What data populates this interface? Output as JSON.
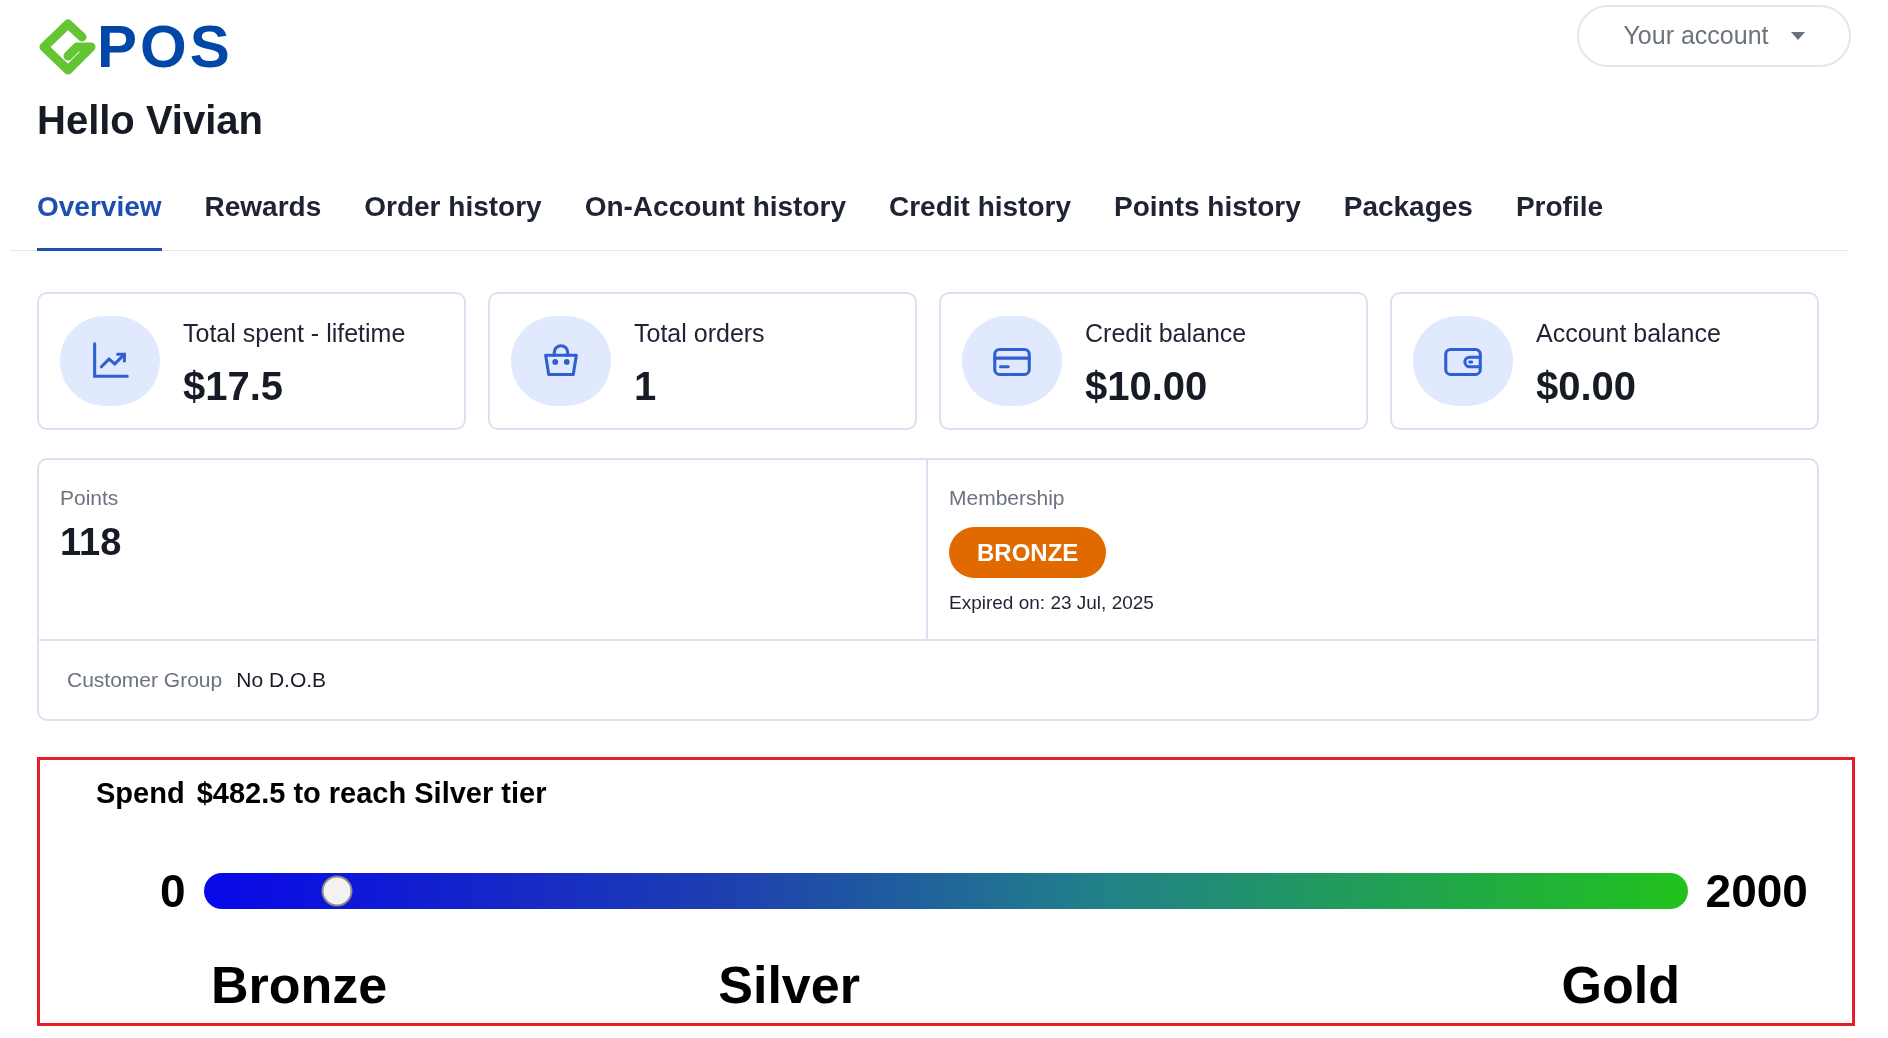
{
  "header": {
    "logo": {
      "text": "POS"
    },
    "greeting": "Hello Vivian",
    "account_button": {
      "label": "Your account"
    }
  },
  "tabs": [
    {
      "label": "Overview",
      "selected": true
    },
    {
      "label": "Rewards",
      "selected": false
    },
    {
      "label": "Order history",
      "selected": false
    },
    {
      "label": "On-Account history",
      "selected": false
    },
    {
      "label": "Credit history",
      "selected": false
    },
    {
      "label": "Points history",
      "selected": false
    },
    {
      "label": "Packages",
      "selected": false
    },
    {
      "label": "Profile",
      "selected": false
    }
  ],
  "stats": [
    {
      "label": "Total spent - lifetime",
      "value": "$17.5"
    },
    {
      "label": "Total orders",
      "value": "1"
    },
    {
      "label": "Credit balance",
      "value": "$10.00"
    },
    {
      "label": "Account balance",
      "value": "$0.00"
    }
  ],
  "points": {
    "label": "Points",
    "value": "118"
  },
  "membership": {
    "label": "Membership",
    "tier": "BRONZE",
    "expiry": "Expired on: 23 Jul, 2025"
  },
  "customer_group": {
    "label": "Customer Group",
    "value": "No D.O.B"
  },
  "tier_progress": {
    "prefix": "Spend",
    "message": "$482.5 to reach Silver tier",
    "min_label": "0",
    "max_label": "2000",
    "level": 0.09,
    "tiers": [
      "Bronze",
      "Silver",
      "Gold"
    ]
  }
}
